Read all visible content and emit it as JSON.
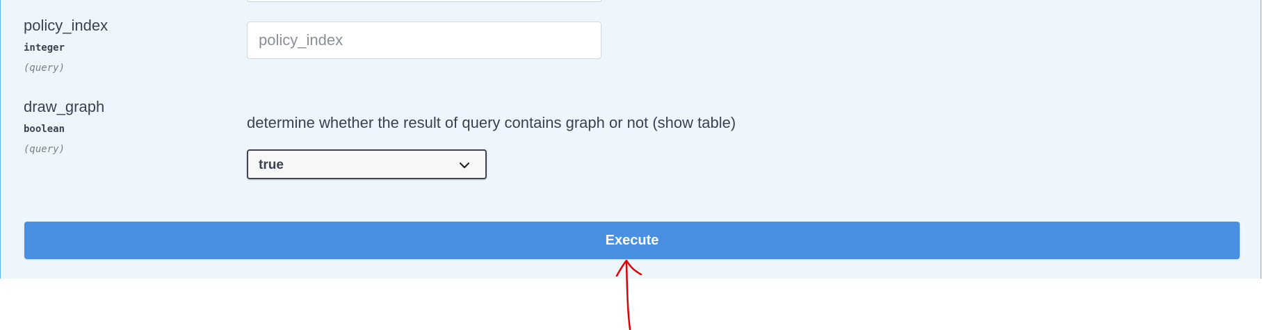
{
  "params": [
    {
      "name": "policy_index",
      "type": "integer",
      "in": "(query)",
      "input_placeholder": "policy_index",
      "input_value": ""
    },
    {
      "name": "draw_graph",
      "type": "boolean",
      "in": "(query)",
      "description": "determine whether the result of query contains graph or not (show table)",
      "selected_value": "true"
    }
  ],
  "execute_label": "Execute",
  "icons": {
    "select_chevron": "chevron-down-icon",
    "annotation": "red-arrow-annotation"
  },
  "colors": {
    "panel_bg": "#eef6fd",
    "panel_border": "#61affe",
    "execute_bg": "#4990e2",
    "annotation": "#e00000"
  }
}
